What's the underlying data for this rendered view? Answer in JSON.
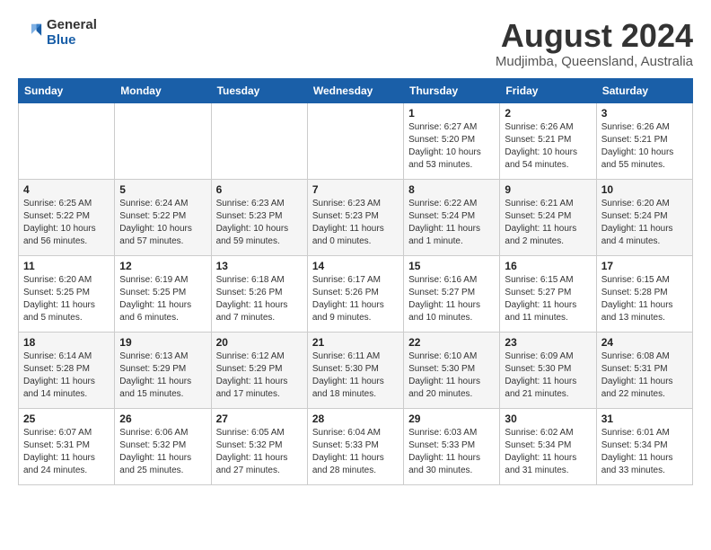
{
  "header": {
    "logo_general": "General",
    "logo_blue": "Blue",
    "main_title": "August 2024",
    "subtitle": "Mudjimba, Queensland, Australia"
  },
  "days_of_week": [
    "Sunday",
    "Monday",
    "Tuesday",
    "Wednesday",
    "Thursday",
    "Friday",
    "Saturday"
  ],
  "weeks": [
    [
      {
        "day": "",
        "sunrise": "",
        "sunset": "",
        "daylight": ""
      },
      {
        "day": "",
        "sunrise": "",
        "sunset": "",
        "daylight": ""
      },
      {
        "day": "",
        "sunrise": "",
        "sunset": "",
        "daylight": ""
      },
      {
        "day": "",
        "sunrise": "",
        "sunset": "",
        "daylight": ""
      },
      {
        "day": "1",
        "sunrise": "Sunrise: 6:27 AM",
        "sunset": "Sunset: 5:20 PM",
        "daylight": "Daylight: 10 hours and 53 minutes."
      },
      {
        "day": "2",
        "sunrise": "Sunrise: 6:26 AM",
        "sunset": "Sunset: 5:21 PM",
        "daylight": "Daylight: 10 hours and 54 minutes."
      },
      {
        "day": "3",
        "sunrise": "Sunrise: 6:26 AM",
        "sunset": "Sunset: 5:21 PM",
        "daylight": "Daylight: 10 hours and 55 minutes."
      }
    ],
    [
      {
        "day": "4",
        "sunrise": "Sunrise: 6:25 AM",
        "sunset": "Sunset: 5:22 PM",
        "daylight": "Daylight: 10 hours and 56 minutes."
      },
      {
        "day": "5",
        "sunrise": "Sunrise: 6:24 AM",
        "sunset": "Sunset: 5:22 PM",
        "daylight": "Daylight: 10 hours and 57 minutes."
      },
      {
        "day": "6",
        "sunrise": "Sunrise: 6:23 AM",
        "sunset": "Sunset: 5:23 PM",
        "daylight": "Daylight: 10 hours and 59 minutes."
      },
      {
        "day": "7",
        "sunrise": "Sunrise: 6:23 AM",
        "sunset": "Sunset: 5:23 PM",
        "daylight": "Daylight: 11 hours and 0 minutes."
      },
      {
        "day": "8",
        "sunrise": "Sunrise: 6:22 AM",
        "sunset": "Sunset: 5:24 PM",
        "daylight": "Daylight: 11 hours and 1 minute."
      },
      {
        "day": "9",
        "sunrise": "Sunrise: 6:21 AM",
        "sunset": "Sunset: 5:24 PM",
        "daylight": "Daylight: 11 hours and 2 minutes."
      },
      {
        "day": "10",
        "sunrise": "Sunrise: 6:20 AM",
        "sunset": "Sunset: 5:24 PM",
        "daylight": "Daylight: 11 hours and 4 minutes."
      }
    ],
    [
      {
        "day": "11",
        "sunrise": "Sunrise: 6:20 AM",
        "sunset": "Sunset: 5:25 PM",
        "daylight": "Daylight: 11 hours and 5 minutes."
      },
      {
        "day": "12",
        "sunrise": "Sunrise: 6:19 AM",
        "sunset": "Sunset: 5:25 PM",
        "daylight": "Daylight: 11 hours and 6 minutes."
      },
      {
        "day": "13",
        "sunrise": "Sunrise: 6:18 AM",
        "sunset": "Sunset: 5:26 PM",
        "daylight": "Daylight: 11 hours and 7 minutes."
      },
      {
        "day": "14",
        "sunrise": "Sunrise: 6:17 AM",
        "sunset": "Sunset: 5:26 PM",
        "daylight": "Daylight: 11 hours and 9 minutes."
      },
      {
        "day": "15",
        "sunrise": "Sunrise: 6:16 AM",
        "sunset": "Sunset: 5:27 PM",
        "daylight": "Daylight: 11 hours and 10 minutes."
      },
      {
        "day": "16",
        "sunrise": "Sunrise: 6:15 AM",
        "sunset": "Sunset: 5:27 PM",
        "daylight": "Daylight: 11 hours and 11 minutes."
      },
      {
        "day": "17",
        "sunrise": "Sunrise: 6:15 AM",
        "sunset": "Sunset: 5:28 PM",
        "daylight": "Daylight: 11 hours and 13 minutes."
      }
    ],
    [
      {
        "day": "18",
        "sunrise": "Sunrise: 6:14 AM",
        "sunset": "Sunset: 5:28 PM",
        "daylight": "Daylight: 11 hours and 14 minutes."
      },
      {
        "day": "19",
        "sunrise": "Sunrise: 6:13 AM",
        "sunset": "Sunset: 5:29 PM",
        "daylight": "Daylight: 11 hours and 15 minutes."
      },
      {
        "day": "20",
        "sunrise": "Sunrise: 6:12 AM",
        "sunset": "Sunset: 5:29 PM",
        "daylight": "Daylight: 11 hours and 17 minutes."
      },
      {
        "day": "21",
        "sunrise": "Sunrise: 6:11 AM",
        "sunset": "Sunset: 5:30 PM",
        "daylight": "Daylight: 11 hours and 18 minutes."
      },
      {
        "day": "22",
        "sunrise": "Sunrise: 6:10 AM",
        "sunset": "Sunset: 5:30 PM",
        "daylight": "Daylight: 11 hours and 20 minutes."
      },
      {
        "day": "23",
        "sunrise": "Sunrise: 6:09 AM",
        "sunset": "Sunset: 5:30 PM",
        "daylight": "Daylight: 11 hours and 21 minutes."
      },
      {
        "day": "24",
        "sunrise": "Sunrise: 6:08 AM",
        "sunset": "Sunset: 5:31 PM",
        "daylight": "Daylight: 11 hours and 22 minutes."
      }
    ],
    [
      {
        "day": "25",
        "sunrise": "Sunrise: 6:07 AM",
        "sunset": "Sunset: 5:31 PM",
        "daylight": "Daylight: 11 hours and 24 minutes."
      },
      {
        "day": "26",
        "sunrise": "Sunrise: 6:06 AM",
        "sunset": "Sunset: 5:32 PM",
        "daylight": "Daylight: 11 hours and 25 minutes."
      },
      {
        "day": "27",
        "sunrise": "Sunrise: 6:05 AM",
        "sunset": "Sunset: 5:32 PM",
        "daylight": "Daylight: 11 hours and 27 minutes."
      },
      {
        "day": "28",
        "sunrise": "Sunrise: 6:04 AM",
        "sunset": "Sunset: 5:33 PM",
        "daylight": "Daylight: 11 hours and 28 minutes."
      },
      {
        "day": "29",
        "sunrise": "Sunrise: 6:03 AM",
        "sunset": "Sunset: 5:33 PM",
        "daylight": "Daylight: 11 hours and 30 minutes."
      },
      {
        "day": "30",
        "sunrise": "Sunrise: 6:02 AM",
        "sunset": "Sunset: 5:34 PM",
        "daylight": "Daylight: 11 hours and 31 minutes."
      },
      {
        "day": "31",
        "sunrise": "Sunrise: 6:01 AM",
        "sunset": "Sunset: 5:34 PM",
        "daylight": "Daylight: 11 hours and 33 minutes."
      }
    ]
  ]
}
